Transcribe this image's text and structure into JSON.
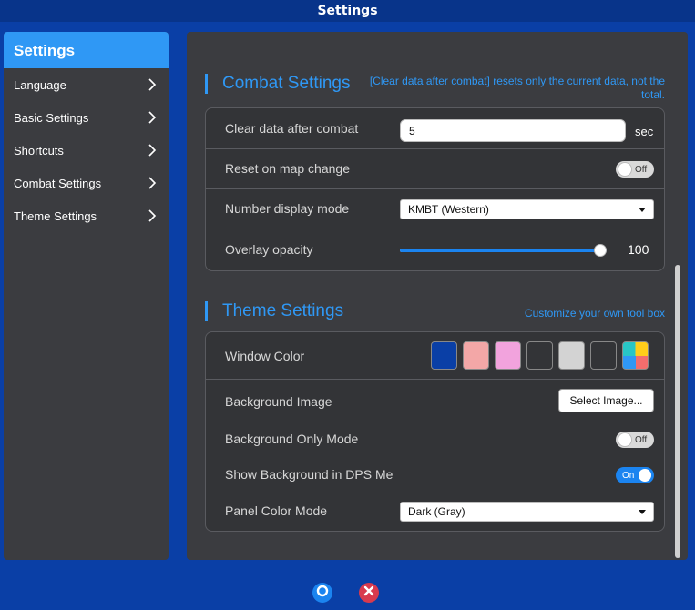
{
  "window": {
    "title": "Settings"
  },
  "sidebar": {
    "header": "Settings",
    "items": [
      {
        "label": "Language"
      },
      {
        "label": "Basic Settings"
      },
      {
        "label": "Shortcuts"
      },
      {
        "label": "Combat Settings"
      },
      {
        "label": "Theme Settings"
      }
    ]
  },
  "combat": {
    "title": "Combat Settings",
    "note": "[Clear data after combat] resets only the current data, not the total.",
    "clear_label": "Clear data after combat",
    "clear_value": "5",
    "clear_unit": "sec",
    "reset_label": "Reset on map change",
    "reset_state": "Off",
    "number_label": "Number display mode",
    "number_value": "KMBT (Western)",
    "opacity_label": "Overlay opacity",
    "opacity_value": "100",
    "opacity_fraction": 1.0
  },
  "theme": {
    "title": "Theme Settings",
    "note": "Customize your own tool box",
    "window_color_label": "Window Color",
    "swatches": [
      "#0a3fa6",
      "#f3a7a7",
      "#f2a3dd",
      "#333437",
      "#d3d3d3",
      "#333437",
      "multicolor"
    ],
    "bg_image_label": "Background Image",
    "bg_image_button": "Select Image...",
    "bg_only_label": "Background Only Mode",
    "bg_only_state": "Off",
    "show_bg_label": "Show Background in DPS Meter",
    "show_bg_state": "On",
    "panel_label": "Panel Color Mode",
    "panel_value": "Dark (Gray)"
  },
  "colors": {
    "accent": "#2f98f5",
    "window": "#0a3fa6",
    "panel": "#3b3c40"
  }
}
